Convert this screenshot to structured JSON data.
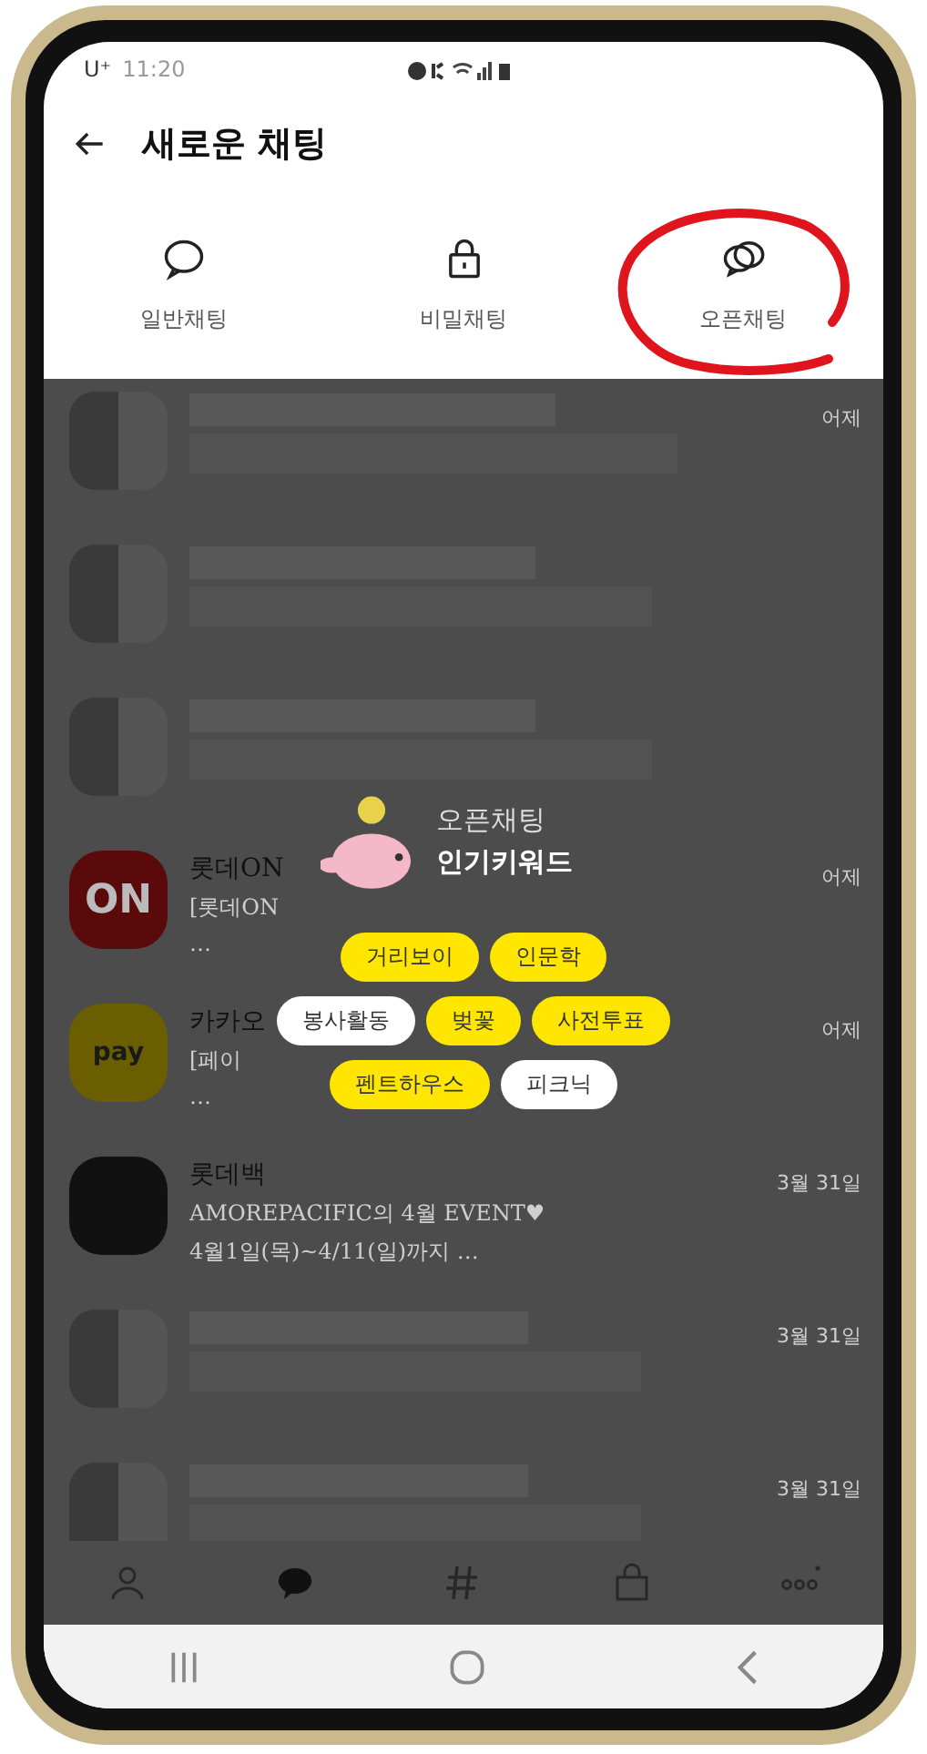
{
  "status_bar": {
    "carrier": "U⁺",
    "time": "11:20"
  },
  "header": {
    "title": "새로운 채팅"
  },
  "chat_types": [
    {
      "label": "일반채팅",
      "kind": "bubble"
    },
    {
      "label": "비밀채팅",
      "kind": "lock"
    },
    {
      "label": "오픈채팅",
      "kind": "bubbles"
    }
  ],
  "chats": [
    {
      "kind": "blurred",
      "time": "어제"
    },
    {
      "kind": "blurred"
    },
    {
      "kind": "blurred"
    },
    {
      "kind": "lotteon",
      "avatar_text": "ON",
      "name": "롯데ON",
      "preview": "[롯데ON",
      "preview_2": "…",
      "time": "어제"
    },
    {
      "kind": "pay",
      "avatar_text": "pay",
      "name": "카카오",
      "preview": "[페이",
      "preview_2": "…",
      "time": "어제"
    },
    {
      "kind": "dark",
      "name": "롯데백",
      "preview": "AMOREPACIFIC의 4월 EVENT♥",
      "preview_2": "4월1일(목)~4/11(일)까지 …",
      "time": "3월 31일"
    },
    {
      "kind": "blurred",
      "time": "3월 31일"
    },
    {
      "kind": "blurred",
      "time": "3월 31일"
    }
  ],
  "popup": {
    "title": "오픈채팅",
    "subtitle": "인기키워드",
    "keywords": [
      {
        "label": "거리보이",
        "color": "#ffe600"
      },
      {
        "label": "인문학",
        "color": "#ffe600"
      },
      {
        "label": "봉사활동",
        "color": "#ffffff"
      },
      {
        "label": "벚꽃",
        "color": "#ffe600"
      },
      {
        "label": "사전투표",
        "color": "#ffe600"
      },
      {
        "label": "펜트하우스",
        "color": "#ffe600"
      },
      {
        "label": "피크닉",
        "color": "#ffffff"
      }
    ]
  },
  "bottom_nav": [
    {
      "kind": "person",
      "selected": false
    },
    {
      "kind": "chat",
      "selected": true
    },
    {
      "kind": "hash",
      "selected": false
    },
    {
      "kind": "bag",
      "selected": false
    },
    {
      "kind": "more",
      "selected": false
    }
  ],
  "system_nav": [
    {
      "kind": "recent"
    },
    {
      "kind": "home"
    },
    {
      "kind": "back"
    }
  ]
}
